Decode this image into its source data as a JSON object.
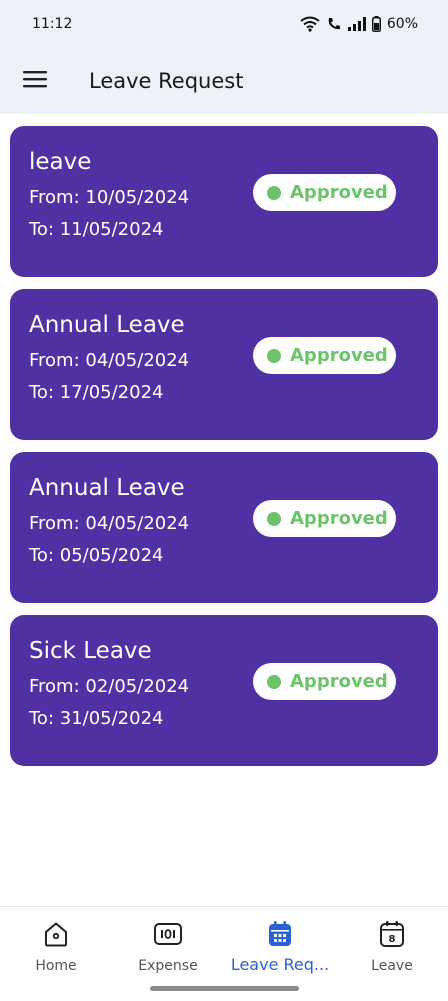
{
  "status_bar": {
    "time": "11:12",
    "battery": "60%"
  },
  "header": {
    "title": "Leave Request"
  },
  "requests": [
    {
      "title": "leave",
      "from": "From: 10/05/2024",
      "to": "To: 11/05/2024",
      "status": "Approved"
    },
    {
      "title": "Annual Leave",
      "from": "From: 04/05/2024",
      "to": "To: 17/05/2024",
      "status": "Approved"
    },
    {
      "title": "Annual Leave",
      "from": "From: 04/05/2024",
      "to": "To: 05/05/2024",
      "status": "Approved"
    },
    {
      "title": "Sick Leave",
      "from": "From: 02/05/2024",
      "to": "To: 31/05/2024",
      "status": "Approved"
    }
  ],
  "bottom_nav": {
    "items": [
      {
        "label": "Home",
        "icon": "home-icon"
      },
      {
        "label": "Expense",
        "icon": "expense-icon"
      },
      {
        "label": "Leave Req...",
        "icon": "calendar-icon",
        "active": true
      },
      {
        "label": "Leave",
        "icon": "calendar-number-icon",
        "badge": "8"
      }
    ]
  },
  "colors": {
    "card": "#5130a4",
    "approved": "#6cc36a",
    "active_nav": "#2a62d6"
  }
}
